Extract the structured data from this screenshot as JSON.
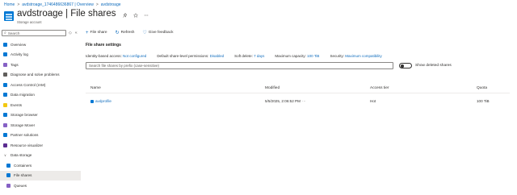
{
  "breadcrumb": {
    "items": [
      "Home",
      "avdstroage_1746486636867 | Overview",
      "avdstroage"
    ],
    "separator": ">"
  },
  "header": {
    "title": "avdstroage | File shares",
    "subtitle": "Storage account",
    "actions": [
      "pin-icon",
      "star-icon",
      "more-icon"
    ]
  },
  "sidebar": {
    "search_placeholder": "Search",
    "search_glyph": "⌕",
    "collapse_glyph": "◇",
    "collapse2_glyph": "«",
    "items": [
      {
        "label": "Overview",
        "icon": "overview-icon",
        "color": "#0078d4"
      },
      {
        "label": "Activity log",
        "icon": "activity-log-icon",
        "color": "#0078d4"
      },
      {
        "label": "Tags",
        "icon": "tag-icon",
        "color": "#8661c5"
      },
      {
        "label": "Diagnose and solve problems",
        "icon": "wrench-icon",
        "color": "#605e5c"
      },
      {
        "label": "Access Control (IAM)",
        "icon": "people-icon",
        "color": "#0078d4"
      },
      {
        "label": "Data migration",
        "icon": "migration-icon",
        "color": "#0078d4"
      },
      {
        "label": "Events",
        "icon": "lightning-icon",
        "color": "#f2c811"
      },
      {
        "label": "Storage browser",
        "icon": "storage-browser-icon",
        "color": "#0078d4"
      },
      {
        "label": "Storage Mover",
        "icon": "storage-mover-icon",
        "color": "#8661c5"
      },
      {
        "label": "Partner solutions",
        "icon": "partner-icon",
        "color": "#0078d4"
      },
      {
        "label": "Resource visualizer",
        "icon": "visualizer-icon",
        "color": "#5c2d91"
      }
    ],
    "group": {
      "label": "Data storage",
      "chevron": "∨"
    },
    "children": [
      {
        "label": "Containers",
        "icon": "containers-icon",
        "color": "#0078d4"
      },
      {
        "label": "File shares",
        "icon": "file-shares-icon",
        "color": "#0078d4"
      },
      {
        "label": "Queues",
        "icon": "queues-icon",
        "color": "#8661c5"
      }
    ]
  },
  "toolbar": {
    "buttons": [
      {
        "label": "File share",
        "glyph": "+"
      },
      {
        "label": "Refresh",
        "glyph": "↻"
      },
      {
        "label": "Give feedback",
        "glyph": "♡"
      }
    ]
  },
  "settings": {
    "title": "File share settings",
    "items": [
      {
        "label": "Identity-based access: ",
        "value": "Not configured"
      },
      {
        "label": "Default share-level permissions: ",
        "value": "Disabled"
      },
      {
        "label": "Soft delete: ",
        "value": "7 days"
      },
      {
        "label": "Maximum capacity: ",
        "value": "100 TiB"
      },
      {
        "label": "Security: ",
        "value": "Maximum compatibility"
      }
    ]
  },
  "filter": {
    "placeholder": "Search file shares by prefix (case-sensitive)",
    "toggle_label": "Show deleted shares",
    "toggle_on": false
  },
  "table": {
    "columns": [
      "Name",
      "Modified",
      "Access tier",
      "Quota"
    ],
    "rows": [
      {
        "name": "avdprofile",
        "modified": "5/5/2025, 2:06:52 PM",
        "more": "···",
        "tier": "Hot",
        "quota": "100 TiB"
      }
    ]
  },
  "colors": {
    "accent": "#0f6cbd",
    "selected_bg": "#edebe9"
  }
}
